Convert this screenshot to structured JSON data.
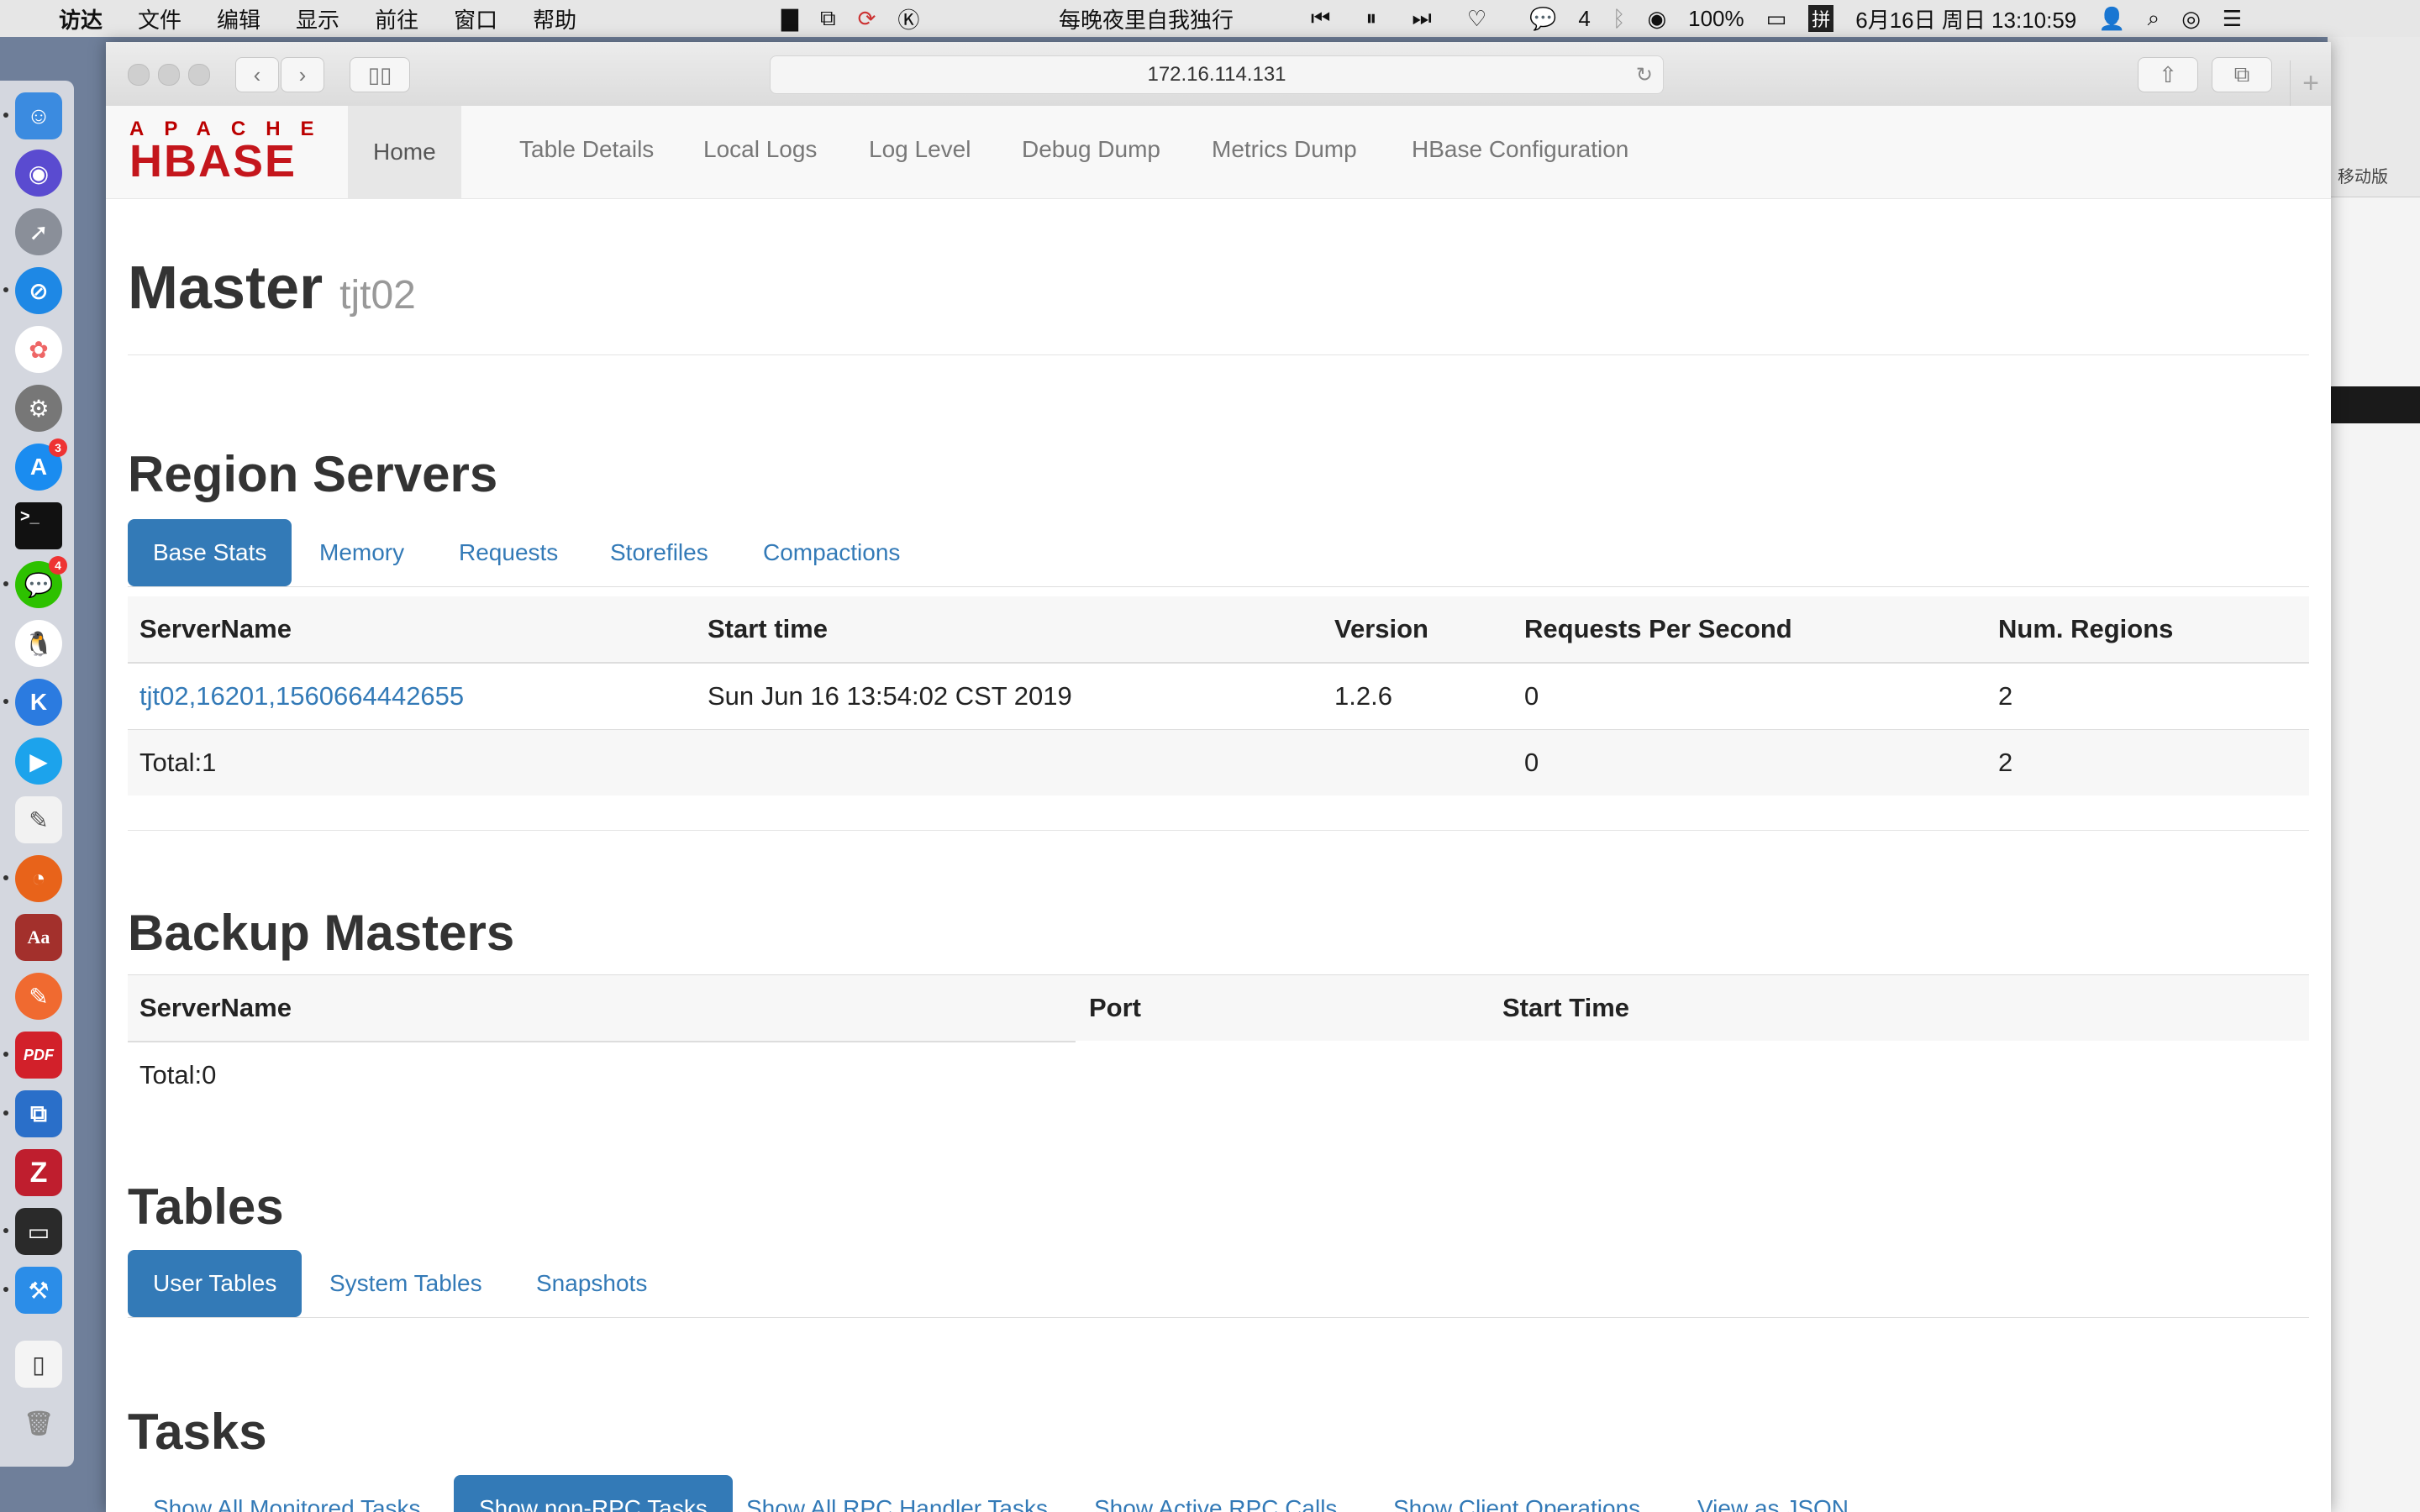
{
  "menubar": {
    "app": "访达",
    "menus": [
      "文件",
      "编辑",
      "显示",
      "前往",
      "窗口",
      "帮助"
    ],
    "now_playing": "每晚夜里自我独行",
    "wechat_count": "4",
    "battery": "100%",
    "input_method": "拼",
    "datetime": "6月16日 周日  13:10:59"
  },
  "dock": {
    "badges": {
      "appstore": "3",
      "wechat": "4"
    }
  },
  "background_window": {
    "label": "移动版"
  },
  "browser": {
    "url": "172.16.114.131"
  },
  "logo": {
    "top": "APACHE",
    "main": "HBASE"
  },
  "nav": [
    "Home",
    "Table Details",
    "Local Logs",
    "Log Level",
    "Debug Dump",
    "Metrics Dump",
    "HBase Configuration"
  ],
  "master": {
    "title": "Master",
    "host": "tjt02"
  },
  "region_servers": {
    "heading": "Region Servers",
    "tabs": [
      "Base Stats",
      "Memory",
      "Requests",
      "Storefiles",
      "Compactions"
    ],
    "columns": [
      "ServerName",
      "Start time",
      "Version",
      "Requests Per Second",
      "Num. Regions"
    ],
    "rows": [
      [
        "tjt02,16201,1560664442655",
        "Sun Jun 16 13:54:02 CST 2019",
        "1.2.6",
        "0",
        "2"
      ]
    ],
    "total": [
      "Total:1",
      "",
      "",
      "0",
      "2"
    ]
  },
  "backup_masters": {
    "heading": "Backup Masters",
    "columns": [
      "ServerName",
      "Port",
      "Start Time"
    ],
    "total": "Total:0"
  },
  "tables": {
    "heading": "Tables",
    "tabs": [
      "User Tables",
      "System Tables",
      "Snapshots"
    ]
  },
  "tasks": {
    "heading": "Tasks",
    "tabs": [
      "Show All Monitored Tasks",
      "Show non-RPC Tasks",
      "Show All RPC Handler Tasks",
      "Show Active RPC Calls",
      "Show Client Operations",
      "View as JSON"
    ]
  }
}
